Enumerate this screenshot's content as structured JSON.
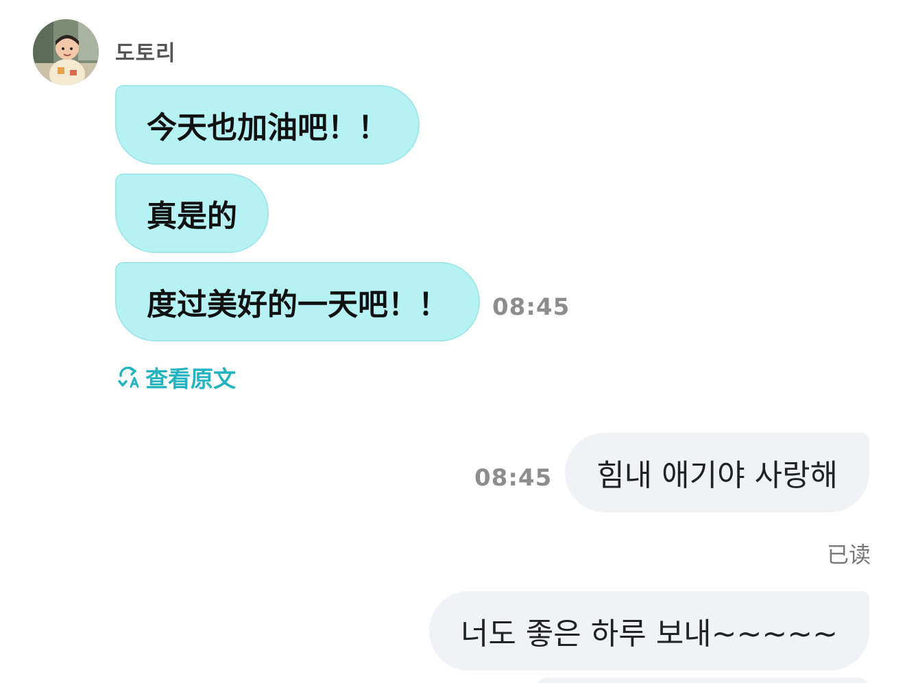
{
  "contact": {
    "name": "도토리",
    "avatar_icon": "avatar-photo"
  },
  "incoming_messages": [
    {
      "text": "今天也加油吧！！"
    },
    {
      "text": "真是的"
    },
    {
      "text": "度过美好的一天吧！！",
      "time": "08:45"
    }
  ],
  "translate_link": {
    "icon": "translate-icon",
    "label": "查看原文"
  },
  "outgoing_messages": [
    {
      "text": "힘내 애기야 사랑해",
      "time": "08:45"
    },
    {
      "text": "너도 좋은 하루 보내~~~~~"
    }
  ],
  "read_status": "已读",
  "colors": {
    "incoming_bubble": "#b6f2f4",
    "outgoing_bubble": "#f1f2f6",
    "link_accent": "#24b3c0",
    "timestamp": "#8d8d8d"
  }
}
